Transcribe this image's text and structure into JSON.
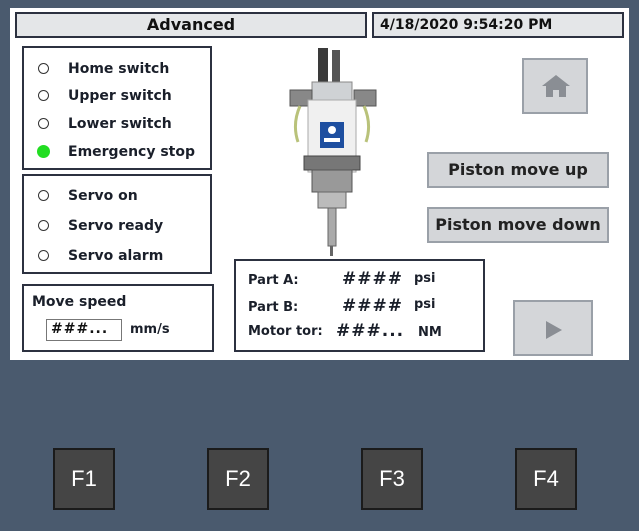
{
  "header": {
    "title": "Advanced",
    "datetime": "4/18/2020 9:54:20 PM"
  },
  "limit_switches": [
    {
      "label": "Home switch",
      "active": false
    },
    {
      "label": "Upper switch",
      "active": false
    },
    {
      "label": "Lower switch",
      "active": false
    },
    {
      "label": "Emergency stop",
      "active": true
    }
  ],
  "servo_status": [
    {
      "label": "Servo on",
      "active": false
    },
    {
      "label": "Servo ready",
      "active": false
    },
    {
      "label": "Servo alarm",
      "active": false
    }
  ],
  "move_speed": {
    "label": "Move speed",
    "value": "###...",
    "unit": "mm/s"
  },
  "readings": {
    "part_a": {
      "label": "Part A:",
      "value": "####",
      "unit": "psi"
    },
    "part_b": {
      "label": "Part B:",
      "value": "####",
      "unit": "psi"
    },
    "motor_torque": {
      "label": "Motor tor:",
      "value": "###...",
      "unit": "NM"
    }
  },
  "buttons": {
    "home_icon": "home-icon",
    "piston_up": "Piston move up",
    "piston_down": "Piston move down",
    "next_icon": "play-icon"
  },
  "function_keys": [
    "F1",
    "F2",
    "F3",
    "F4"
  ],
  "colors": {
    "led_on": "#22dd22",
    "background": "#4a5a6e",
    "button_face": "#d4d6d9",
    "fkey_face": "#454545"
  }
}
